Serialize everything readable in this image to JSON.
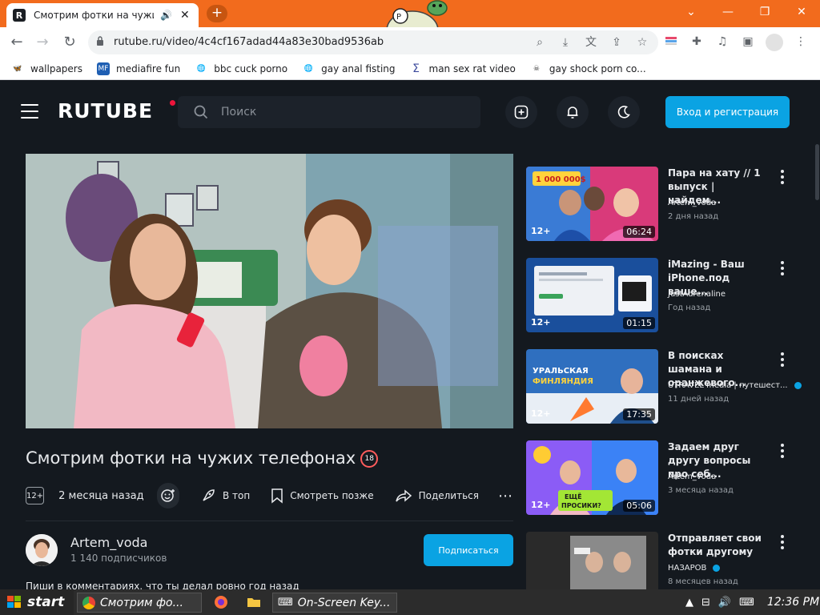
{
  "browser": {
    "tab_title": "Смотрим фотки на чужих",
    "tab_close": "✕",
    "new_tab": "+",
    "url": "rutube.ru/video/4c4cf167adad44a83e30bad9536ab",
    "window": {
      "minimize": "⌄",
      "restore": "—",
      "maximize": "❐",
      "close": "✕"
    }
  },
  "bookmarks": [
    {
      "label": "wallpapers",
      "icon": "butterfly-icon",
      "color": "#9aa0a6"
    },
    {
      "label": "mediafire fun",
      "icon": "mediafire-icon",
      "color": "#1f5fb3"
    },
    {
      "label": "bbc cuck porno",
      "icon": "globe-icon",
      "color": "#3c4043"
    },
    {
      "label": "gay anal fisting",
      "icon": "globe-icon",
      "color": "#3c4043"
    },
    {
      "label": "man sex rat video",
      "icon": "sigma-icon",
      "color": "#3c4043"
    },
    {
      "label": "gay shock porn co...",
      "icon": "skull-icon",
      "color": "#3c4043"
    }
  ],
  "header": {
    "logo": "RUTUBE",
    "search_placeholder": "Поиск",
    "login_label": "Вход и регистрация"
  },
  "video": {
    "title": "Смотрим фотки на чужих телефонах",
    "age_icon": "18",
    "age_badge": "12+",
    "date": "2 месяца назад",
    "actions": {
      "top": "В топ",
      "watch_later": "Смотреть позже",
      "share": "Поделиться"
    },
    "channel": {
      "name": "Artem_voda",
      "subscribers": "1 140 подписчиков",
      "subscribe_label": "Подписаться"
    },
    "description": "Пиши в комментариях, что ты делал ровно год назад"
  },
  "recommendations": [
    {
      "title": "Пара на хату // 1 выпуск | найдем...",
      "channel": "Artem_voda",
      "date": "2 дня назад",
      "age": "12+",
      "duration": "06:24",
      "verified": false
    },
    {
      "title": "iMazing - Ваш iPhone.под ваше...",
      "channel": "JustAdrenaline",
      "date": "Год назад",
      "age": "12+",
      "duration": "01:15",
      "verified": false
    },
    {
      "title": "В поисках шамана и оранжевого...",
      "channel": "UTRAVEL media | путешест...",
      "date": "11 дней назад",
      "age": "12+",
      "duration": "17:35",
      "verified": true
    },
    {
      "title": "Задаем друг другу вопросы про себ...",
      "channel": "Artem_voda",
      "date": "3 месяца назад",
      "age": "12+",
      "duration": "05:06",
      "verified": false
    },
    {
      "title": "Отправляет свои фотки другому",
      "channel": "НАЗАРОВ",
      "date": "8 месяцев назад",
      "age": "",
      "duration": "",
      "verified": true
    }
  ],
  "thumb_texts": {
    "rec0_badge": "1 000 000$",
    "rec2_line1": "УРАЛЬСКАЯ",
    "rec2_line2": "ФИНЛЯНДИЯ",
    "rec3_line1": "ЕЩЁ",
    "rec3_line2": "ПРОСИКИ?"
  },
  "taskbar": {
    "start": "start",
    "tasks": [
      "Смотрим фо...",
      "On-Screen Key..."
    ],
    "clock": "12:36 PM"
  },
  "colors": {
    "browser_accent": "#f26b1d",
    "rutube_bg": "#14191f",
    "rutube_blue": "#0aa3e3",
    "rutube_red": "#ed143b"
  }
}
